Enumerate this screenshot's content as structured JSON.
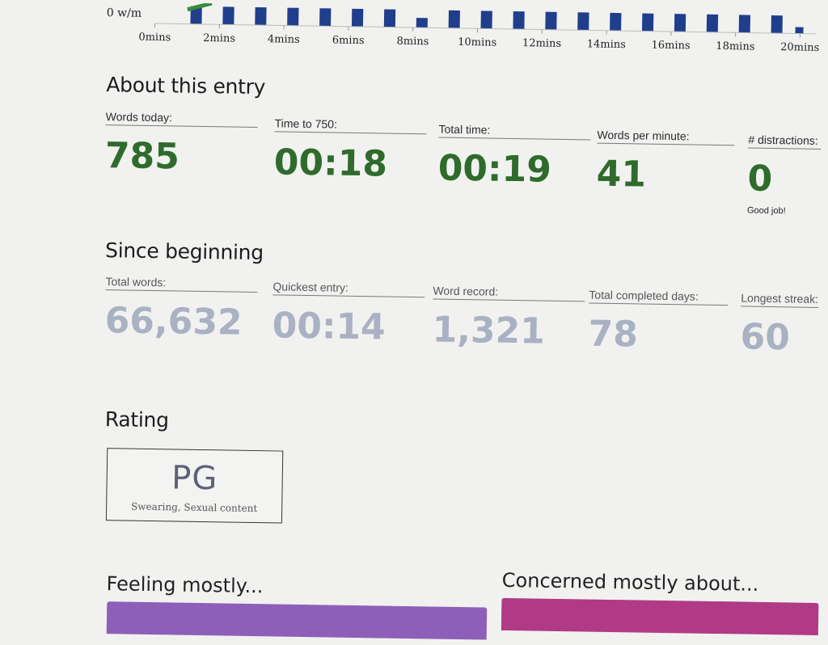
{
  "chart": {
    "y_label": "0 w/m",
    "x_ticks": [
      "0mins",
      "2mins",
      "4mins",
      "6mins",
      "8mins",
      "10mins",
      "12mins",
      "14mins",
      "16mins",
      "18mins",
      "20mins"
    ],
    "bar_color": "#1f3e8c",
    "line_color": "#3a8a3a"
  },
  "about_entry": {
    "title": "About this entry",
    "stats": [
      {
        "label": "Words today:",
        "value": "785"
      },
      {
        "label": "Time to 750:",
        "value": "00:18"
      },
      {
        "label": "Total time:",
        "value": "00:19"
      },
      {
        "label": "Words per minute:",
        "value": "41"
      },
      {
        "label": "# distractions:",
        "value": "0",
        "note": "Good job!"
      }
    ]
  },
  "since_beginning": {
    "title": "Since beginning",
    "stats": [
      {
        "label": "Total words:",
        "value": "66,632"
      },
      {
        "label": "Quickest entry:",
        "value": "00:14"
      },
      {
        "label": "Word record:",
        "value": "1,321"
      },
      {
        "label": "Total completed days:",
        "value": "78"
      },
      {
        "label": "Longest streak:",
        "value": "60"
      }
    ]
  },
  "rating": {
    "title": "Rating",
    "value": "PG",
    "description": "Swearing, Sexual content"
  },
  "feeling": {
    "title": "Feeling mostly...",
    "bar_color": "#8e5fb8"
  },
  "concerned": {
    "title": "Concerned mostly about...",
    "bar_color": "#b03a86"
  },
  "colors": {
    "today_value": "#2f6b2c",
    "since_value": "#aab1c2"
  }
}
